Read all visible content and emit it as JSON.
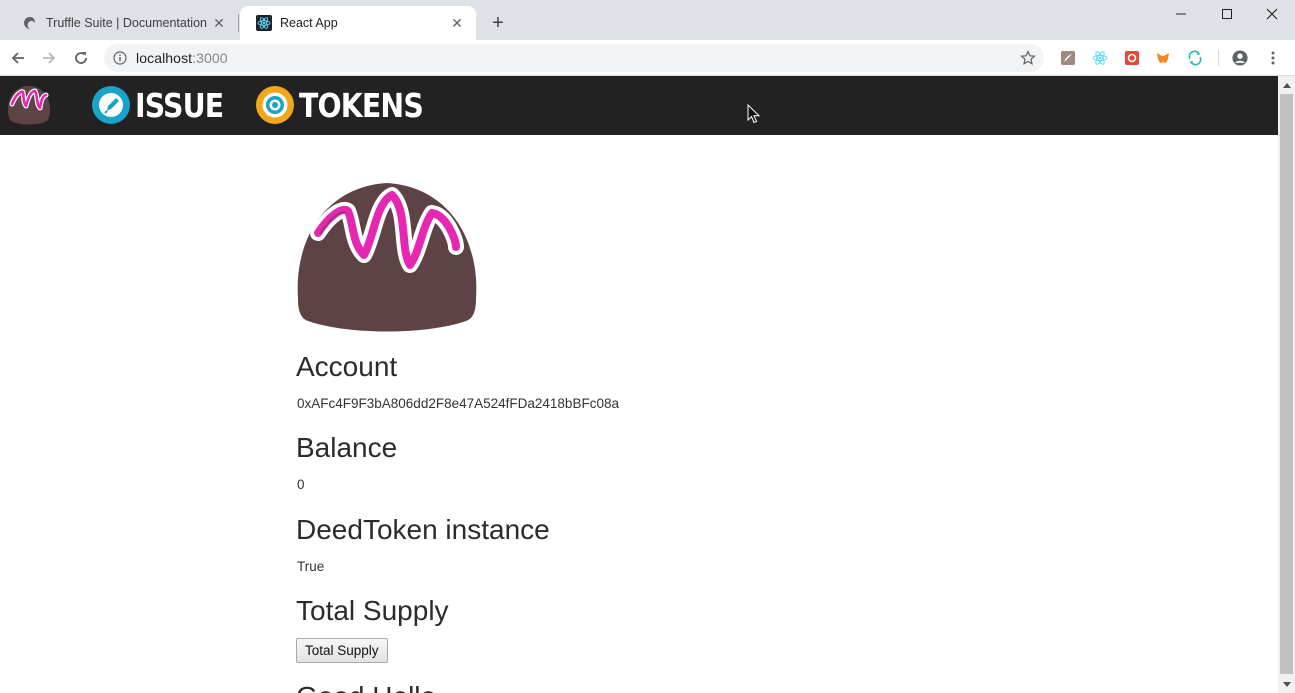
{
  "browser": {
    "tabs": [
      {
        "title": "Truffle Suite | Documentation |",
        "favicon": "truffle-icon",
        "active": false
      },
      {
        "title": "React App",
        "favicon": "react-icon",
        "active": true
      }
    ],
    "url_host": "localhost",
    "url_port": ":3000",
    "extensions": [
      "pdf-icon",
      "react-devtools-icon",
      "grammarly-icon",
      "metamask-icon",
      "sync-icon"
    ],
    "profile_icon": "account-circle-icon",
    "menu_icon": "kebab-menu-icon"
  },
  "navbar": {
    "links": [
      {
        "label": "ISSUE",
        "icon": "edit-icon",
        "icon_color": "#1aa3c8"
      },
      {
        "label": "TOKENS",
        "icon": "target-icon",
        "icon_color": "#f2a71b"
      }
    ],
    "background": "#222222",
    "logo": "truffle-drop-logo"
  },
  "main": {
    "account_heading": "Account",
    "account_value": "0xAFc4F9F3bA806dd2F8e47A524fFDa2418bBFc08a",
    "balance_heading": "Balance",
    "balance_value": "0",
    "instance_heading": "DeedToken instance",
    "instance_value": "True",
    "supply_heading": "Total Supply",
    "supply_button": "Total Supply",
    "next_heading": "Good Hello"
  },
  "colors": {
    "drop_body": "#5e4346",
    "drop_stripe": "#e627b2"
  }
}
